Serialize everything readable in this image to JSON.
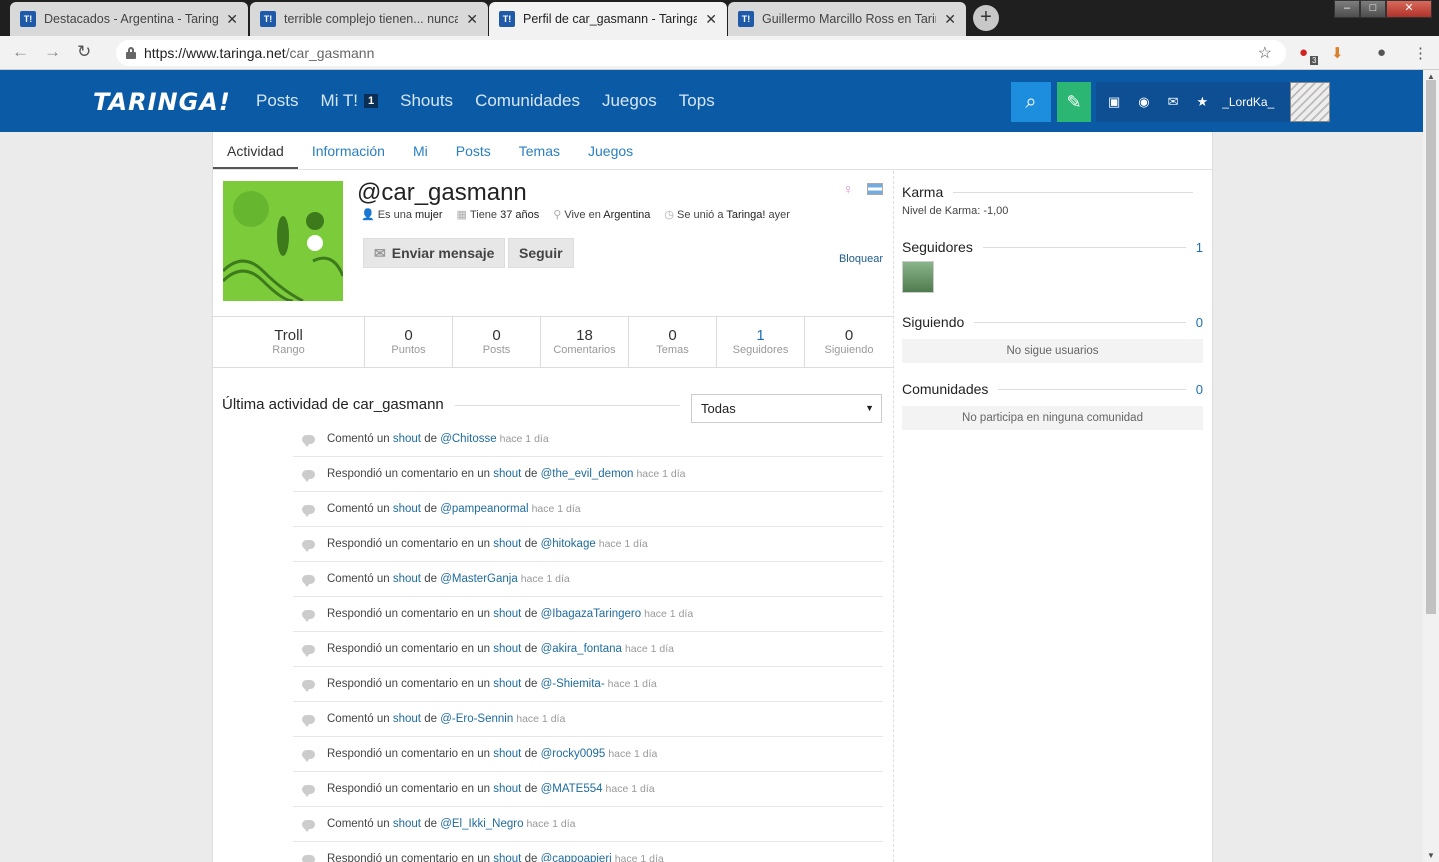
{
  "browser": {
    "tabs": [
      {
        "title": "Destacados - Argentina - Taringa!"
      },
      {
        "title": "terrible complejo tienen... nunca"
      },
      {
        "title": "Perfil de car_gasmann - Taringa!"
      },
      {
        "title": "Guillermo Marcillo Ross en Taringa!"
      }
    ],
    "favicon": "T!",
    "url_host": "https://www.taringa.net",
    "url_path": "/car_gasmann",
    "ext_badge": "3"
  },
  "header": {
    "logo": "TARINGA!",
    "nav": [
      "Posts",
      "Mi T!",
      "Shouts",
      "Comunidades",
      "Juegos",
      "Tops"
    ],
    "mit_badge": "1",
    "username": "_LordKa_"
  },
  "subnav": [
    "Actividad",
    "Información",
    "Mi",
    "Posts",
    "Temas",
    "Juegos"
  ],
  "profile": {
    "name": "@car_gasmann",
    "gender_text": "Es una",
    "gender": "mujer",
    "age_text": "Tiene",
    "age": "37 años",
    "lives_text": "Vive en",
    "lives": "Argentina",
    "joined_text": "Se unió a",
    "joined": "Taringa!",
    "joined_when": "ayer",
    "send_message": "Enviar mensaje",
    "follow": "Seguir",
    "block": "Bloquear"
  },
  "stats": [
    {
      "value": "Troll",
      "label": "Rango"
    },
    {
      "value": "0",
      "label": "Puntos"
    },
    {
      "value": "0",
      "label": "Posts"
    },
    {
      "value": "18",
      "label": "Comentarios"
    },
    {
      "value": "0",
      "label": "Temas"
    },
    {
      "value": "1",
      "label": "Seguidores"
    },
    {
      "value": "0",
      "label": "Siguiendo"
    }
  ],
  "activity": {
    "title": "Última actividad de car_gasmann",
    "filter": "Todas",
    "items": [
      {
        "pre": "Comentó un",
        "obj": "shout",
        "mid": "de",
        "user": "@Chitosse",
        "time": "hace 1 día"
      },
      {
        "pre": "Respondió un comentario en un",
        "obj": "shout",
        "mid": "de",
        "user": "@the_evil_demon",
        "time": "hace 1 día"
      },
      {
        "pre": "Comentó un",
        "obj": "shout",
        "mid": "de",
        "user": "@pampeanormal",
        "time": "hace 1 día"
      },
      {
        "pre": "Respondió un comentario en un",
        "obj": "shout",
        "mid": "de",
        "user": "@hitokage",
        "time": "hace 1 día"
      },
      {
        "pre": "Comentó un",
        "obj": "shout",
        "mid": "de",
        "user": "@MasterGanja",
        "time": "hace 1 día"
      },
      {
        "pre": "Respondió un comentario en un",
        "obj": "shout",
        "mid": "de",
        "user": "@IbagazaTaringero",
        "time": "hace 1 día"
      },
      {
        "pre": "Respondió un comentario en un",
        "obj": "shout",
        "mid": "de",
        "user": "@akira_fontana",
        "time": "hace 1 día"
      },
      {
        "pre": "Respondió un comentario en un",
        "obj": "shout",
        "mid": "de",
        "user": "@-Shiemita-",
        "time": "hace 1 día"
      },
      {
        "pre": "Comentó un",
        "obj": "shout",
        "mid": "de",
        "user": "@-Ero-Sennin",
        "time": "hace 1 día"
      },
      {
        "pre": "Respondió un comentario en un",
        "obj": "shout",
        "mid": "de",
        "user": "@rocky0095",
        "time": "hace 1 día"
      },
      {
        "pre": "Respondió un comentario en un",
        "obj": "shout",
        "mid": "de",
        "user": "@MATE554",
        "time": "hace 1 día"
      },
      {
        "pre": "Comentó un",
        "obj": "shout",
        "mid": "de",
        "user": "@El_Ikki_Negro",
        "time": "hace 1 día"
      },
      {
        "pre": "Respondió un comentario en un",
        "obj": "shout",
        "mid": "de",
        "user": "@cappoapieri",
        "time": "hace 1 día"
      }
    ]
  },
  "sidebar": {
    "karma_title": "Karma",
    "karma_label": "Nivel de Karma:",
    "karma_value": "-1,00",
    "followers_title": "Seguidores",
    "followers_count": "1",
    "following_title": "Siguiendo",
    "following_count": "0",
    "following_empty": "No sigue usuarios",
    "communities_title": "Comunidades",
    "communities_count": "0",
    "communities_empty": "No participa en ninguna comunidad"
  },
  "colors": {
    "header": "#0a5aa6",
    "link": "#1e6b9e",
    "post_button": "#2bb673"
  }
}
